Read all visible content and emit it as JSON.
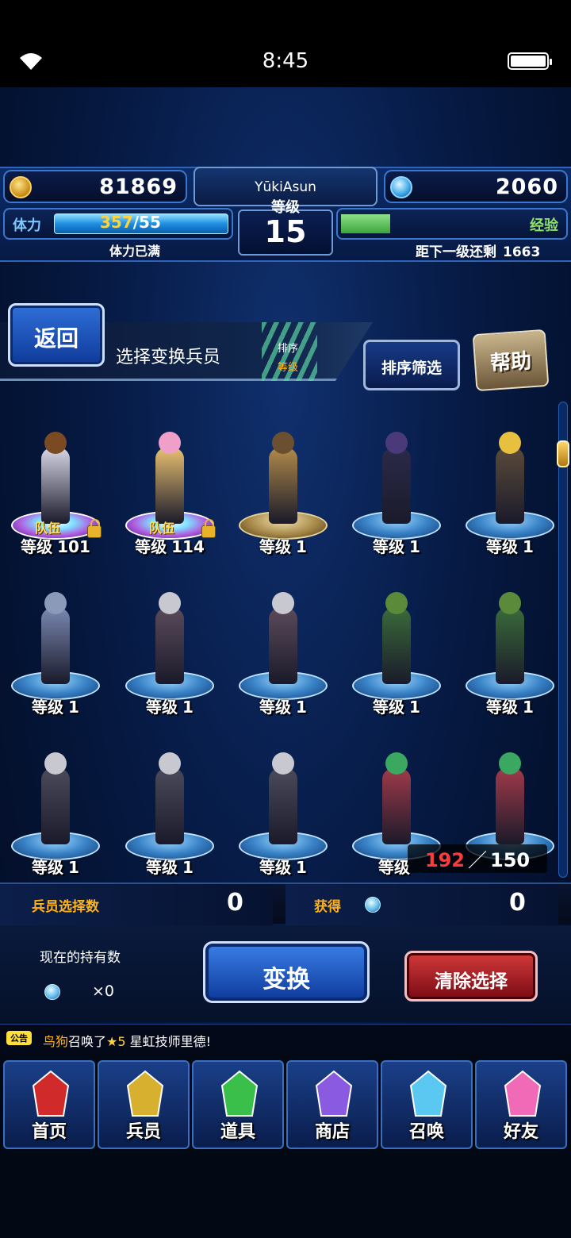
{
  "status_bar": {
    "time": "8:45"
  },
  "player": {
    "gil": "81869",
    "name": "YūkiAsun",
    "level_label": "等级",
    "level": "15",
    "gems": "2060",
    "stamina_label": "体力",
    "stamina_current": "357",
    "stamina_max": "/55",
    "stamina_status": "体力已满",
    "exp_label": "经验",
    "exp_next_label": "距下一级还剩",
    "exp_next_value": "1663",
    "exp_fill": 0.22
  },
  "toolbar": {
    "back_label": "返回",
    "page_title": "选择变换兵员",
    "sort_label": "排序",
    "sort_value": "等级",
    "filter_label": "排序筛选",
    "help_label": "帮助"
  },
  "units": [
    {
      "level_label": "等级",
      "level": "101",
      "party_label": "队伍",
      "locked": true,
      "style": "party",
      "color": "#d7d7e8",
      "hair": "#7a4a22"
    },
    {
      "level_label": "等级",
      "level": "114",
      "party_label": "队伍",
      "locked": true,
      "style": "party",
      "color": "#e8c070",
      "hair": "#f0a0c8"
    },
    {
      "level_label": "等级",
      "level": "1",
      "style": "gold",
      "color": "#b08a4a",
      "hair": "#6a5030"
    },
    {
      "level_label": "等级",
      "level": "1",
      "style": "blue",
      "color": "#2a2a4a",
      "hair": "#4a3a7a"
    },
    {
      "level_label": "等级",
      "level": "1",
      "style": "blue",
      "color": "#5a4a3a",
      "hair": "#e8c040"
    },
    {
      "level_label": "等级",
      "level": "1",
      "style": "blue",
      "color": "#7a88b0",
      "hair": "#8a9ab8"
    },
    {
      "level_label": "等级",
      "level": "1",
      "style": "blue",
      "color": "#5a4a5a",
      "hair": "#c8c8d0"
    },
    {
      "level_label": "等级",
      "level": "1",
      "style": "blue",
      "color": "#5a4a5a",
      "hair": "#c8c8d0"
    },
    {
      "level_label": "等级",
      "level": "1",
      "style": "blue",
      "color": "#3a6a3a",
      "hair": "#5a8a3a"
    },
    {
      "level_label": "等级",
      "level": "1",
      "style": "blue",
      "color": "#3a6a3a",
      "hair": "#5a8a3a"
    },
    {
      "level_label": "等级",
      "level": "1",
      "style": "blue",
      "color": "#4a4a5a",
      "hair": "#c8c8d0"
    },
    {
      "level_label": "等级",
      "level": "1",
      "style": "blue",
      "color": "#4a4a5a",
      "hair": "#c8c8d0"
    },
    {
      "level_label": "等级",
      "level": "1",
      "style": "blue",
      "color": "#4a4a5a",
      "hair": "#c8c8d0"
    },
    {
      "level_label": "等级",
      "level": "",
      "style": "blue",
      "color": "#a03a4a",
      "hair": "#3aa860"
    },
    {
      "level_label": "",
      "level": "",
      "style": "blue",
      "color": "#a03a4a",
      "hair": "#3aa860"
    }
  ],
  "capacity": {
    "current": "192",
    "separator": "／",
    "max": "150"
  },
  "counters": {
    "selected_label": "兵员选择数",
    "selected_value": "0",
    "gain_label": "获得",
    "gain_value": "0"
  },
  "actions": {
    "own_label": "现在的持有数",
    "own_value": "×0",
    "convert_label": "变换",
    "clear_label": "清除选择"
  },
  "notice": {
    "badge": "公告",
    "who": "鸟狗",
    "text_mid": "召唤了",
    "star": "★5",
    "text_end": " 星虹技师里德!"
  },
  "nav": [
    {
      "label": "首页",
      "icon": "sword-icon",
      "color": "#d02a2a"
    },
    {
      "label": "兵员",
      "icon": "warrior-icon",
      "color": "#d8b030"
    },
    {
      "label": "道具",
      "icon": "potion-icon",
      "color": "#3ac04a"
    },
    {
      "label": "商店",
      "icon": "shop-icon",
      "color": "#8a5ae0"
    },
    {
      "label": "召唤",
      "icon": "crystal-icon",
      "color": "#5ac8f0"
    },
    {
      "label": "好友",
      "icon": "friends-icon",
      "color": "#f06ab8"
    }
  ]
}
